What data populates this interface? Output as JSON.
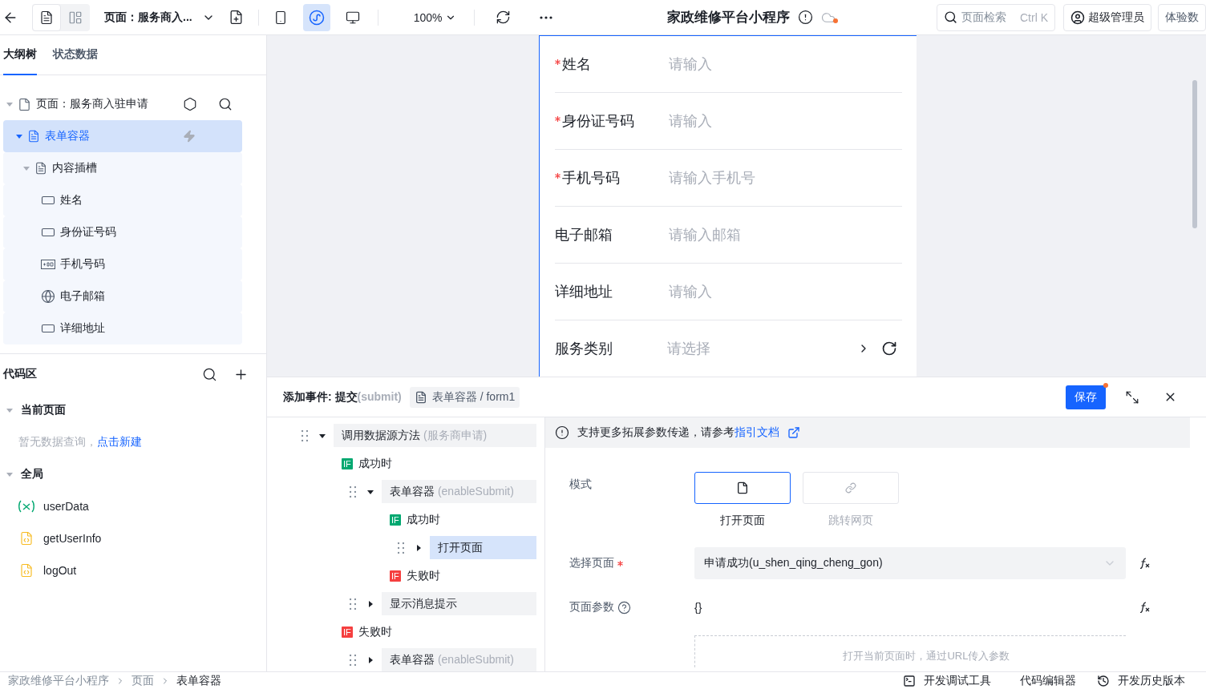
{
  "toolbar": {
    "page_title": "页面：服务商入...",
    "view_modes": [
      {
        "kind": "outline",
        "selected": true
      },
      {
        "kind": "layout",
        "selected": false
      }
    ],
    "devices": [
      {
        "kind": "mobile",
        "selected": false
      },
      {
        "kind": "miniprogram",
        "selected": true
      },
      {
        "kind": "desktop",
        "selected": false
      }
    ],
    "zoom": "100%",
    "app_title": "家政维修平台小程序",
    "unsaved": true,
    "search": {
      "placeholder": "页面检索",
      "shortcut": "Ctrl K"
    },
    "user": "超级管理员",
    "experience": "体验数"
  },
  "left_tabs": [
    {
      "label": "大纲树",
      "selected": true
    },
    {
      "label": "状态数据",
      "selected": false
    }
  ],
  "outline": [
    {
      "label": "页面：服务商入驻申请",
      "kind": "page",
      "expanded": true,
      "selected": false,
      "children": [
        {
          "label": "表单容器",
          "kind": "form",
          "expanded": true,
          "selected": true,
          "children": [
            {
              "label": "内容插槽",
              "kind": "slot",
              "expanded": true,
              "selected": false,
              "children": [
                {
                  "label": "姓名",
                  "kind": "input",
                  "selected": false
                },
                {
                  "label": "身份证号码",
                  "kind": "input",
                  "selected": false
                },
                {
                  "label": "手机号码",
                  "kind": "phone",
                  "selected": false
                },
                {
                  "label": "电子邮箱",
                  "kind": "email",
                  "selected": false
                },
                {
                  "label": "详细地址",
                  "kind": "input",
                  "selected": false
                }
              ]
            }
          ]
        }
      ]
    }
  ],
  "code_area": {
    "title": "代码区",
    "sections": [
      {
        "title": "当前页面",
        "expanded": true,
        "empty_text": "暂无数据查询，",
        "link": "点击新建"
      },
      {
        "title": "全局",
        "expanded": true,
        "items": [
          {
            "name": "userData",
            "kind": "variable"
          },
          {
            "name": "getUserInfo",
            "kind": "script"
          },
          {
            "name": "logOut",
            "kind": "script"
          }
        ]
      }
    ]
  },
  "form": {
    "fields": [
      {
        "label": "姓名",
        "required": true,
        "placeholder": "请输入",
        "kind": "input"
      },
      {
        "label": "身份证号码",
        "required": true,
        "placeholder": "请输入",
        "kind": "input"
      },
      {
        "label": "手机号码",
        "required": true,
        "placeholder": "请输入手机号",
        "kind": "input"
      },
      {
        "label": "电子邮箱",
        "required": false,
        "placeholder": "请输入邮箱",
        "kind": "input"
      },
      {
        "label": "详细地址",
        "required": false,
        "placeholder": "请输入",
        "kind": "input"
      },
      {
        "label": "服务类别",
        "required": false,
        "placeholder": "请选择",
        "kind": "select"
      }
    ]
  },
  "event_panel": {
    "title": "添加事件: 提交",
    "event_code": "(submit)",
    "target": "表单容器 / form1",
    "save": "保存",
    "unsaved": true,
    "actions": [
      {
        "kind": "action",
        "label": "调用数据源方法",
        "detail": "(服务商申请)",
        "expanded": true,
        "selected": false,
        "children": [
          {
            "kind": "branch",
            "tag": "IF",
            "label": "成功时",
            "color": "#00a870",
            "children": [
              {
                "kind": "action",
                "label": "表单容器",
                "detail": "(enableSubmit)",
                "expanded": true,
                "selected": false,
                "children": [
                  {
                    "kind": "branch",
                    "tag": "IF",
                    "label": "成功时",
                    "color": "#00a870",
                    "children": [
                      {
                        "kind": "action",
                        "label": "打开页面",
                        "expanded": false,
                        "selected": true
                      }
                    ]
                  },
                  {
                    "kind": "branch",
                    "tag": "IF",
                    "label": "失败时",
                    "color": "#f53f3f"
                  }
                ]
              },
              {
                "kind": "action",
                "label": "显示消息提示",
                "expanded": false,
                "selected": false
              }
            ]
          },
          {
            "kind": "branch",
            "tag": "IF",
            "label": "失败时",
            "color": "#f53f3f",
            "children": [
              {
                "kind": "action",
                "label": "表单容器",
                "detail": "(enableSubmit)",
                "expanded": false,
                "selected": false
              }
            ]
          }
        ]
      }
    ],
    "config": {
      "notice": "支持更多拓展参数传递，请参考",
      "notice_link": "指引文档",
      "mode_label": "模式",
      "modes": [
        {
          "label": "打开页面",
          "kind": "page",
          "selected": true
        },
        {
          "label": "跳转网页",
          "kind": "link",
          "selected": false
        }
      ],
      "page_label": "选择页面",
      "page_required": true,
      "page_value": "申请成功(u_shen_qing_cheng_gon)",
      "params_label": "页面参数",
      "params_value": "{}",
      "params_hint": "打开当前页面时，通过URL传入参数"
    }
  },
  "status_bar": {
    "breadcrumb": [
      "家政维修平台小程序",
      "页面",
      "表单容器"
    ],
    "tools": [
      {
        "label": "开发调试工具",
        "kind": "debug"
      },
      {
        "label": "代码编辑器",
        "kind": "code"
      },
      {
        "label": "开发历史版本",
        "kind": "history"
      }
    ]
  }
}
